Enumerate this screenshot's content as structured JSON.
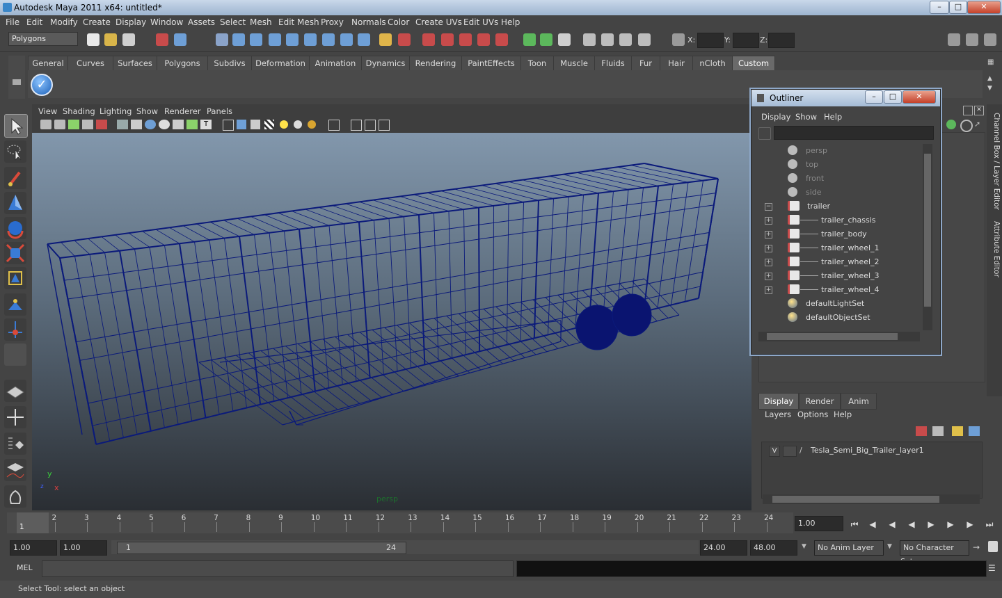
{
  "window": {
    "title": "Autodesk Maya 2011 x64: untitled*"
  },
  "menubar": [
    "File",
    "Edit",
    "Modify",
    "Create",
    "Display",
    "Window",
    "Assets",
    "Select",
    "Mesh",
    "Edit Mesh",
    "Proxy",
    "Normals",
    "Color",
    "Create UVs",
    "Edit UVs",
    "Help"
  ],
  "statusline": {
    "mode": "Polygons",
    "x_label": "X:",
    "y_label": "Y:",
    "z_label": "Z:"
  },
  "shelf": {
    "tabs": [
      "General",
      "Curves",
      "Surfaces",
      "Polygons",
      "Subdivs",
      "Deformation",
      "Animation",
      "Dynamics",
      "Rendering",
      "PaintEffects",
      "Toon",
      "Muscle",
      "Fluids",
      "Fur",
      "Hair",
      "nCloth",
      "Custom"
    ],
    "active_tab": "Custom"
  },
  "viewport": {
    "menus": [
      "View",
      "Shading",
      "Lighting",
      "Show",
      "Renderer",
      "Panels"
    ],
    "camera_label": "persp",
    "axis": {
      "y": "y",
      "x": "x",
      "z": "z"
    },
    "wire_color": "#0b1a7a"
  },
  "outliner": {
    "title": "Outliner",
    "menus": [
      "Display",
      "Show",
      "Help"
    ],
    "items": [
      {
        "label": "persp",
        "type": "camera",
        "depth": 0,
        "dim": true
      },
      {
        "label": "top",
        "type": "camera",
        "depth": 0,
        "dim": true
      },
      {
        "label": "front",
        "type": "camera",
        "depth": 0,
        "dim": true
      },
      {
        "label": "side",
        "type": "camera",
        "depth": 0,
        "dim": true
      },
      {
        "label": "trailer",
        "type": "mesh",
        "depth": 0,
        "expander": "−"
      },
      {
        "label": "trailer_chassis",
        "type": "mesh",
        "depth": 1,
        "expander": "+"
      },
      {
        "label": "trailer_body",
        "type": "mesh",
        "depth": 1,
        "expander": "+"
      },
      {
        "label": "trailer_wheel_1",
        "type": "mesh",
        "depth": 1,
        "expander": "+"
      },
      {
        "label": "trailer_wheel_2",
        "type": "mesh",
        "depth": 1,
        "expander": "+"
      },
      {
        "label": "trailer_wheel_3",
        "type": "mesh",
        "depth": 1,
        "expander": "+"
      },
      {
        "label": "trailer_wheel_4",
        "type": "mesh",
        "depth": 1,
        "expander": "+"
      },
      {
        "label": "defaultLightSet",
        "type": "set",
        "depth": 0
      },
      {
        "label": "defaultObjectSet",
        "type": "set",
        "depth": 0
      }
    ]
  },
  "side_tabs": [
    "Channel Box / Layer Editor",
    "Attribute Editor"
  ],
  "layer_editor": {
    "tabs": [
      "Display",
      "Render",
      "Anim"
    ],
    "active_tab": "Display",
    "menus": [
      "Layers",
      "Options",
      "Help"
    ],
    "layer": {
      "visible": "V",
      "name": "Tesla_Semi_Big_Trailer_layer1"
    }
  },
  "timeline": {
    "ticks": [
      "1",
      "2",
      "3",
      "4",
      "5",
      "6",
      "7",
      "8",
      "9",
      "10",
      "11",
      "12",
      "13",
      "14",
      "15",
      "16",
      "17",
      "18",
      "19",
      "20",
      "21",
      "22",
      "23",
      "24"
    ],
    "current_marker": "1",
    "current_frame": "1.00"
  },
  "range": {
    "start": "1.00",
    "playback_start": "1.00",
    "slider_start": "1",
    "slider_end": "24",
    "playback_end": "24.00",
    "end": "48.00",
    "anim_layer": "No Anim Layer",
    "character_set": "No Character Set"
  },
  "command": {
    "label": "MEL"
  },
  "helpline": {
    "text": "Select Tool: select an object"
  },
  "colors": {
    "accent": "#5e5e5e",
    "viewport_top": "#8297ac",
    "viewport_bottom": "#2a2e33"
  }
}
